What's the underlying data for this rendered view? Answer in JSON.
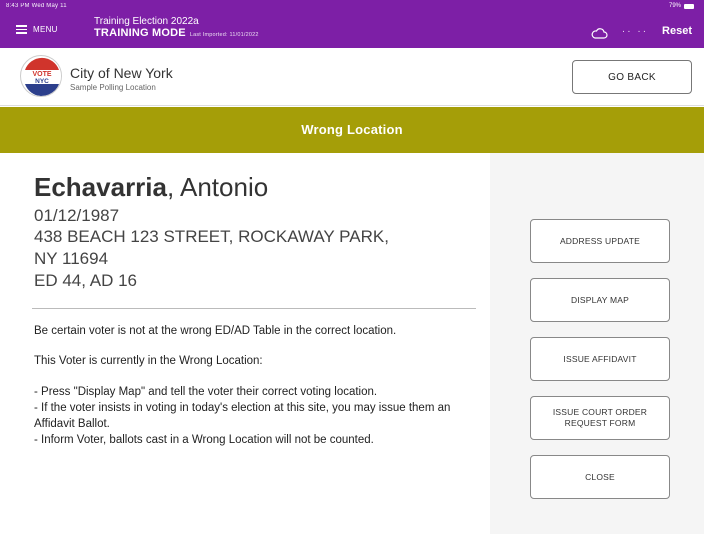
{
  "status_bar": {
    "time": "8:43 PM  Wed May 11",
    "battery": "79%"
  },
  "topbar": {
    "menu_label": "MENU",
    "election_title": "Training Election 2022a",
    "mode_label": "TRAINING MODE",
    "last_imported": "Last Imported: 11/01/2022",
    "user_glyph": "·· ··",
    "reset_label": "Reset"
  },
  "header": {
    "logo_text": "VOTE NYC",
    "org_name": "City of New York",
    "location": "Sample Polling Location",
    "go_back_label": "GO BACK"
  },
  "banner": {
    "title": "Wrong Location"
  },
  "voter": {
    "last_name": "Echavarria",
    "first_name": "Antonio",
    "dob": "01/12/1987",
    "address_line1": "438 BEACH 123 STREET, ROCKAWAY PARK,",
    "address_line2": "NY 11694",
    "district": "ED 44, AD 16"
  },
  "message": {
    "para1": "Be certain voter is not at the wrong ED/AD Table in the correct location.",
    "para2": "This Voter is currently in the Wrong Location:",
    "bullet1": "- Press \"Display Map\" and tell the voter their correct voting location.",
    "bullet2": "- If the voter insists in voting in today's election at this site, you may issue them an Affidavit Ballot.",
    "bullet3": "- Inform Voter, ballots cast in a Wrong Location will not be counted."
  },
  "actions": {
    "address_update": "ADDRESS UPDATE",
    "display_map": "DISPLAY MAP",
    "issue_affidavit": "ISSUE AFFIDAVIT",
    "issue_court_order_line1": "ISSUE COURT ORDER",
    "issue_court_order_line2": "REQUEST FORM",
    "close": "CLOSE"
  },
  "icons": {
    "menu": "hamburger-icon",
    "cloud": "cloud-icon",
    "users": "users-icon",
    "logo": "vote-nyc-logo"
  },
  "colors": {
    "topbar": "#7d1fa6",
    "banner": "#a59e08",
    "logo_red": "#d0342c",
    "logo_blue": "#2c3f8c"
  }
}
